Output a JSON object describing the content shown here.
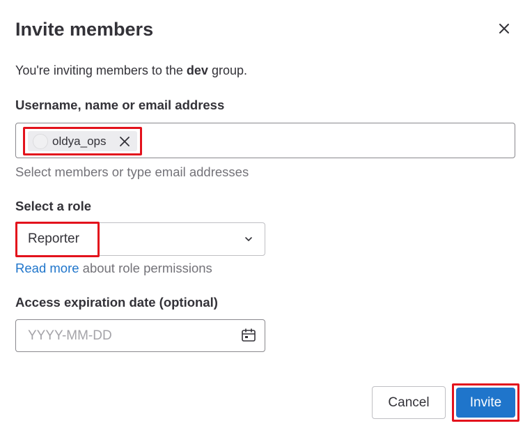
{
  "modal": {
    "title": "Invite members",
    "intro_prefix": "You're inviting members to the ",
    "group_name": "dev",
    "intro_suffix": " group."
  },
  "members": {
    "label": "Username, name or email address",
    "tokens": [
      {
        "name": "oldya_ops"
      }
    ],
    "help": "Select members or type email addresses"
  },
  "role": {
    "label": "Select a role",
    "selected": "Reporter",
    "read_more_link": "Read more",
    "read_more_suffix": " about role permissions"
  },
  "expiration": {
    "label": "Access expiration date (optional)",
    "placeholder": "YYYY-MM-DD"
  },
  "footer": {
    "cancel_label": "Cancel",
    "invite_label": "Invite"
  },
  "colors": {
    "primary": "#1f75cb",
    "highlight": "#e3121c",
    "text": "#333238",
    "muted": "#737278"
  },
  "icons": [
    "close-icon",
    "token-remove-icon",
    "chevron-down-icon",
    "calendar-icon"
  ]
}
